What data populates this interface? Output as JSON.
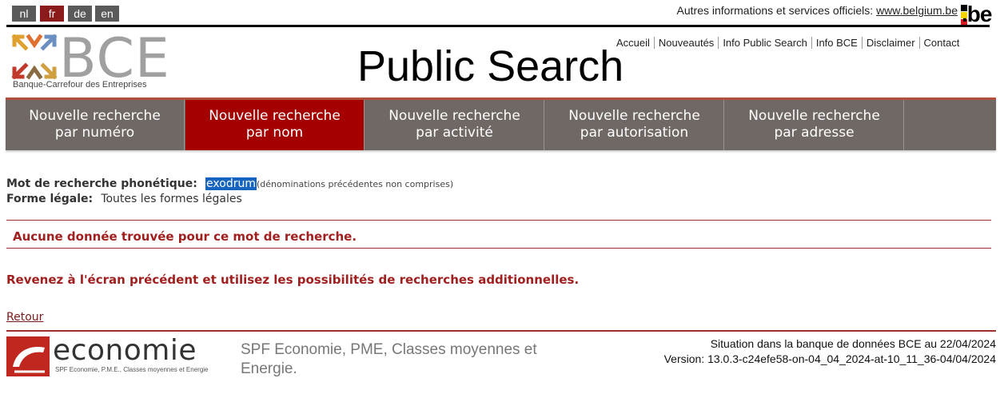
{
  "languages": [
    "nl",
    "fr",
    "de",
    "en"
  ],
  "active_language": "fr",
  "header": {
    "official_text": "Autres informations et services officiels:",
    "official_link": "www.belgium.be",
    "be_logo": ".be",
    "bce_logo": "BCE",
    "bce_subtitle": "Banque-Carrefour des Entreprises",
    "title": "Public Search",
    "links": [
      "Accueil",
      "Nouveautés",
      "Info Public Search",
      "Info BCE",
      "Disclaimer",
      "Contact"
    ]
  },
  "nav": {
    "tabs": [
      {
        "line1": "Nouvelle recherche",
        "line2": "par numéro"
      },
      {
        "line1": "Nouvelle recherche",
        "line2": "par nom"
      },
      {
        "line1": "Nouvelle recherche",
        "line2": "par activité"
      },
      {
        "line1": "Nouvelle recherche",
        "line2": "par autorisation"
      },
      {
        "line1": "Nouvelle recherche",
        "line2": "par adresse"
      }
    ],
    "active_index": 1
  },
  "search": {
    "phonetic_label": "Mot de recherche phonétique:",
    "phonetic_value": "exodrum",
    "phonetic_note": "(dénominations précédentes non comprises)",
    "legal_label": "Forme légale:",
    "legal_value": "Toutes les formes légales"
  },
  "messages": {
    "no_data": "Aucune donnée trouvée pour ce mot de recherche.",
    "go_back": "Revenez à l'écran précédent et utilisez les possibilités de recherches additionnelles."
  },
  "retour": "Retour",
  "footer": {
    "economie_logo": "economie",
    "economie_sub": "SPF Economie, P.M.E., Classes moyennes et Energie",
    "spf": "SPF Economie, PME, Classes moyennes et Energie.",
    "situation": "Situation dans la banque de données BCE au 22/04/2024",
    "version": "Version: 13.0.3-c24efe58-on-04_04_2024-at-10_11_36-04/04/2024"
  },
  "colors": {
    "accent_red": "#a50000",
    "nav_gray": "#706864",
    "error_red": "#a02020"
  }
}
